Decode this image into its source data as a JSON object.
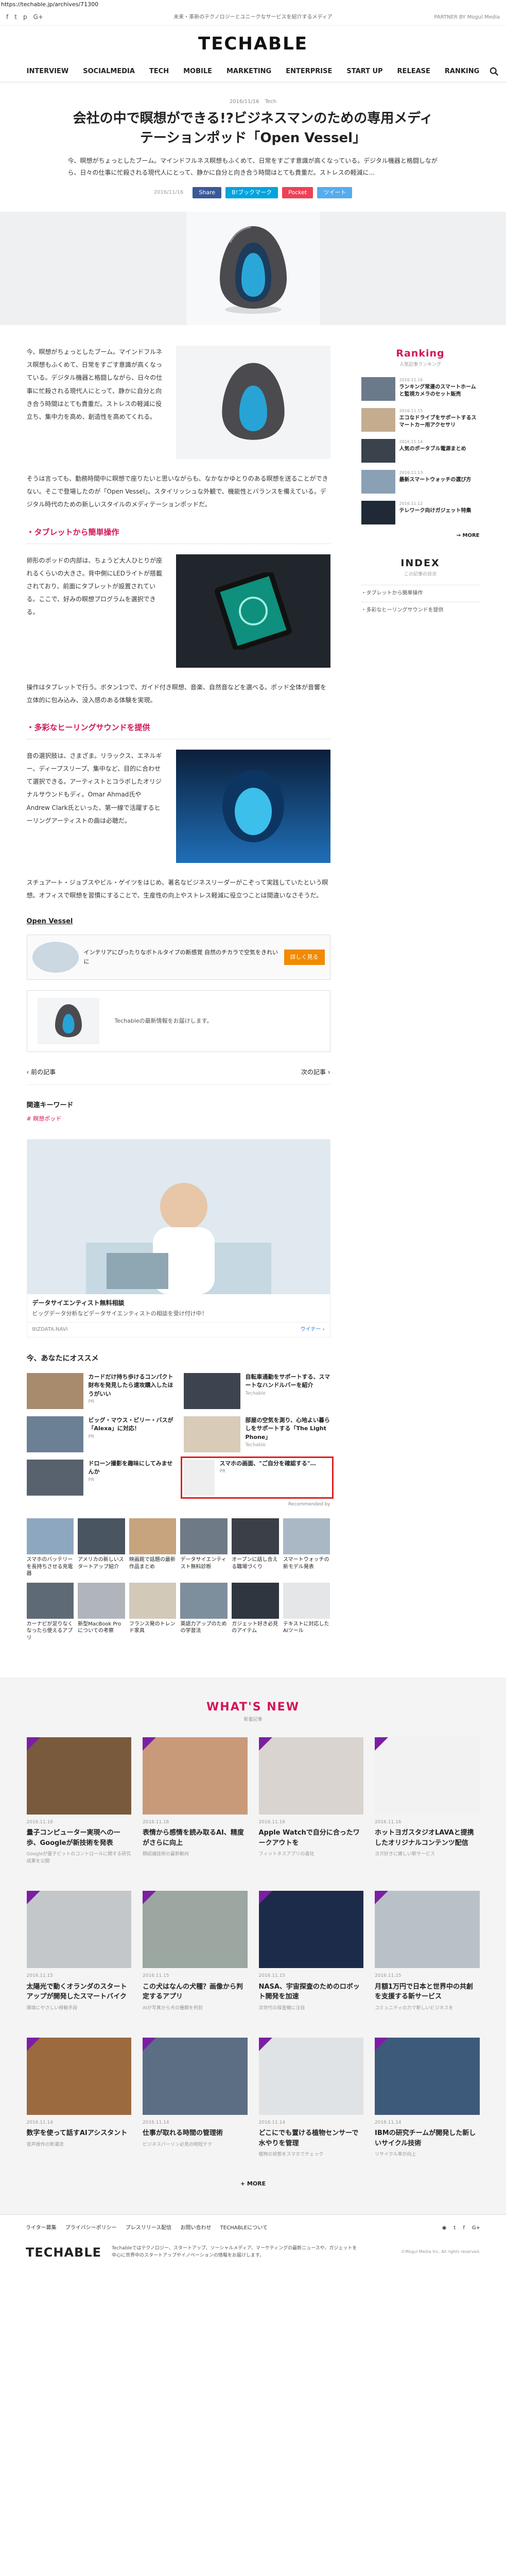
{
  "browser": {
    "url": "https://techable.jp/archives/71300"
  },
  "topbar": {
    "social": [
      "f",
      "t",
      "p",
      "G+"
    ],
    "tagline": "未来・革新のテクノロジーとユニークなサービスを紹介するメディア",
    "partner": "PARTNER BY Mogul Media"
  },
  "header": {
    "logo": "TECHABLE"
  },
  "nav": [
    "INTERVIEW",
    "SOCIALMEDIA",
    "TECH",
    "MOBILE",
    "MARKETING",
    "ENTERPRISE",
    "START UP",
    "RELEASE",
    "RANKING"
  ],
  "article": {
    "date": "2016/11/16",
    "category": "Tech",
    "title": "会社の中で瞑想ができる!?ビジネスマンのための専用メディテーションポッド「Open Vessel」",
    "lead": "今、瞑想がちょっとしたブーム。マインドフルネス瞑想もふくめて、日常をすごす意識が高くなっている。デジタル機器と格闘しながら、日々の仕事に忙殺される現代人にとって、静かに自分と向き合う時間はとても貴重だ。ストレスの軽減に...",
    "share_date": "2016/11/16",
    "share": [
      "Share",
      "B!ブックマーク",
      "Pocket",
      "ツイート"
    ],
    "p1": "今、瞑想がちょっとしたブーム。マインドフルネス瞑想もふくめて、日常をすごす意識が高くなっている。デジタル機器と格闘しながら、日々の仕事に忙殺される現代人にとって、静かに自分と向き合う時間はとても貴重だ。ストレスの軽減に役立ち、集中力を高め、創造性を高めてくれる。",
    "p2": "そうは言っても、勤務時間中に瞑想で座りたいと思いながらも、なかなかゆとりのある瞑想を送ることができない。そこで登場したのが「Open Vessel」。スタイリッシュな外観で、機能性とバランスを備えている。デジタル時代のための新しいスタイルのメディテーションポッドだ。",
    "h1": "・タブレットから簡単操作",
    "p3": "卵形のポッドの内部は、ちょうど大人ひとりが座れるくらいの大きさ。背中側にLEDライトが搭載されており、前面にタブレットが設置されている。ここで、好みの瞑想プログラムを選択できる。",
    "p4": "操作はタブレットで行う。ボタン1つで、ガイド付き瞑想、音楽、自然音などを選べる。ポッド全体が音響を立体的に包み込み、没入感のある体験を実現。",
    "h2": "・多彩なヒーリングサウンドを提供",
    "p5": "音の選択肢は、さまざま。リラックス、エネルギー、ディープスリープ、集中など、目的に合わせて選択できる。アーティストとコラボしたオリジナルサウンドもディ。Omar Ahmad氏やAndrew Clark氏といった、第一線で活躍するヒーリングアーティストの曲は必聴だ。",
    "p6": "スチュアート・ジョブスやビル・ゲイツをはじめ、著名なビジネスリーダーがこぞって実践していたという瞑想。オフィスで瞑想を習慣にすることで、生産性の向上やストレス軽減に役立つことは間違いなさそうだ。",
    "source_label": "Open Vessel",
    "ad_text": "インテリアにぴったりなボトルタイプの新感覚 自然のチカラで空気をきれいに",
    "ad_button": "詳しく見る",
    "embed_text": "Techableの最新情報をお届けします。",
    "prev": "‹ 前の記事",
    "next": "次の記事 ›",
    "keyword_title": "関連キーワード",
    "keyword": "# 瞑想ポッド",
    "promo_caption": "データサイエンティスト無料相談",
    "promo_desc": "ビッグデータ分析などデータサイエンティストの相談を受け付け中！",
    "promo_source": "BIZDATA.NAVI",
    "promo_more": "ウイナー ›"
  },
  "recommend": {
    "title": "今、あなたにオススメ",
    "items": [
      {
        "t": "カードだけ持ち歩けるコンパクト財布を発見したら速攻購入したほうがいい",
        "s": "PR"
      },
      {
        "t": "自転車通勤をサポートする、スマートなハンドルバーを紹介",
        "s": "Techable"
      },
      {
        "t": "ビッグ・マウス・ビリー・バスが「Alexa」に対応！",
        "s": "PR"
      },
      {
        "t": "部屋の空気を測り、心地よい暮らしをサポートする「The Light Phone」",
        "s": "Techable"
      },
      {
        "t": "ドローン撮影を趣味にしてみませんか",
        "s": "PR"
      },
      {
        "t": "スマホの画面、\"ご自分を確認する\"…",
        "s": "PR"
      }
    ],
    "ad_by": "Recommended by",
    "grid": [
      {
        "t": "スマホのバッテリーを長持ちさせる充電器"
      },
      {
        "t": "アメリカの新しいスタートアップ紹介"
      },
      {
        "t": "映画館で話題の最新作品まとめ"
      },
      {
        "t": "データサイエンティスト無料診断"
      },
      {
        "t": "オープンに話し合える職場づくり"
      },
      {
        "t": "スマートウォッチの新モデル発表"
      },
      {
        "t": "カーナビが足りなくなったら使えるアプリ"
      },
      {
        "t": "新型MacBook Proについての考察"
      },
      {
        "t": "フランス発のトレンド家具"
      },
      {
        "t": "英語力アップのための学習法"
      },
      {
        "t": "ガジェット好き必見のアイテム"
      },
      {
        "t": "テキストに対応したAIツール"
      }
    ]
  },
  "sidebar": {
    "ranking_title": "Ranking",
    "ranking_sub": "人気記事ランキング",
    "ranking": [
      {
        "d": "2016.11.16",
        "t": "ランキング常連のスマートホームと監視カメラのセット販売"
      },
      {
        "d": "2016.11.15",
        "t": "エコなドライブをサポートするスマートカー用アクセサリ"
      },
      {
        "d": "2016.11.14",
        "t": "人気のポータブル電源まとめ"
      },
      {
        "d": "2016.11.13",
        "t": "最新スマートウォッチの選び方"
      },
      {
        "d": "2016.11.12",
        "t": "テレワーク向けガジェット特集"
      }
    ],
    "ranking_more": "→ MORE",
    "index_title": "INDEX",
    "index_sub": "この記事の目次",
    "index": [
      "・タブレットから簡単操作",
      "・多彩なヒーリングサウンドを提供"
    ]
  },
  "whatsnew": {
    "title": "WHAT'S NEW",
    "sub": "新着記事",
    "cards": [
      {
        "d": "2016.11.16",
        "t": "量子コンピューター実現への一歩、Googleが新技術を発表",
        "e": "Googleが量子ビットのコントロールに関する研究成果を公開"
      },
      {
        "d": "2016.11.16",
        "t": "表情から感情を読み取るAI、精度がさらに向上",
        "e": "顔認識技術の最新動向"
      },
      {
        "d": "2016.11.16",
        "t": "Apple Watchで自分に合ったワークアウトを",
        "e": "フィットネスアプリの進化"
      },
      {
        "d": "2016.11.16",
        "t": "ホットヨガスタジオLAVAと提携したオリジナルコンテンツ配信",
        "e": "ヨガ好きに嬉しい新サービス"
      },
      {
        "d": "2016.11.15",
        "t": "太陽光で動くオランダのスタートアップが開発したスマートバイク",
        "e": "環境にやさしい移動手段"
      },
      {
        "d": "2016.11.15",
        "t": "この犬はなんの犬種？画像から判定するアプリ",
        "e": "AIが写真から犬の種類を判別"
      },
      {
        "d": "2016.11.15",
        "t": "NASA、宇宙探査のためのロボット開発を加速",
        "e": "次世代の探査機に注目"
      },
      {
        "d": "2016.11.15",
        "t": "月額1万円で日本と世界中の共創を支援する新サービス",
        "e": "コミュニティの力で新しいビジネスを"
      },
      {
        "d": "2016.11.14",
        "t": "数字を使って話すAIアシスタント",
        "e": "音声操作の新潮流"
      },
      {
        "d": "2016.11.14",
        "t": "仕事が取れる時間の管理術",
        "e": "ビジネスパーソン必見の時短テク"
      },
      {
        "d": "2016.11.14",
        "t": "どこにでも置ける植物センサーで水やりを管理",
        "e": "植物の状態をスマホでチェック"
      },
      {
        "d": "2016.11.14",
        "t": "IBMの研究チームが開発した新しいサイクル技術",
        "e": "リサイクル率が向上"
      }
    ],
    "more": "+ MORE"
  },
  "footer": {
    "links": [
      "ライター募集",
      "プライバシーポリシー",
      "プレスリリース配信",
      "お問い合わせ",
      "TECHABLEについて"
    ],
    "logo": "TECHABLE",
    "text": "Techableではテクノロジー、スタートアップ、ソーシャルメディア、マーケティングの最新ニュースや、ガジェットを中心に世界中のスタートアップやイノベーションの情報をお届けします。",
    "copy": "©Mogul Media Inc. All rights reserved."
  }
}
